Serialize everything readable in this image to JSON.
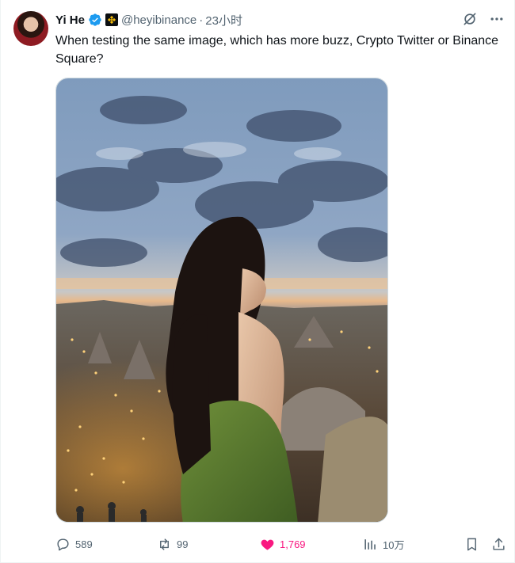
{
  "tweet": {
    "author_name": "Yi He",
    "author_handle": "@heyibinance",
    "separator": "·",
    "timestamp": "23小时",
    "text": "When testing the same image, which has more buzz, Crypto Twitter or Binance Square?",
    "media": {
      "type": "photo"
    }
  },
  "stats": {
    "replies": "589",
    "reposts": "99",
    "likes": "1,769",
    "views": "10万"
  },
  "colors": {
    "text_primary": "#0f1419",
    "text_secondary": "#536471",
    "verified": "#1d9bf0",
    "liked": "#f91880",
    "affiliate_badge": "#f0b90b"
  },
  "icons": {
    "verified": "verified-badge-icon",
    "affiliate": "binance-logo-icon",
    "grok": "grok-icon",
    "more": "more-icon",
    "reply": "reply-icon",
    "repost": "repost-icon",
    "like": "heart-filled-icon",
    "views": "views-chart-icon",
    "bookmark": "bookmark-icon",
    "share": "share-icon"
  }
}
